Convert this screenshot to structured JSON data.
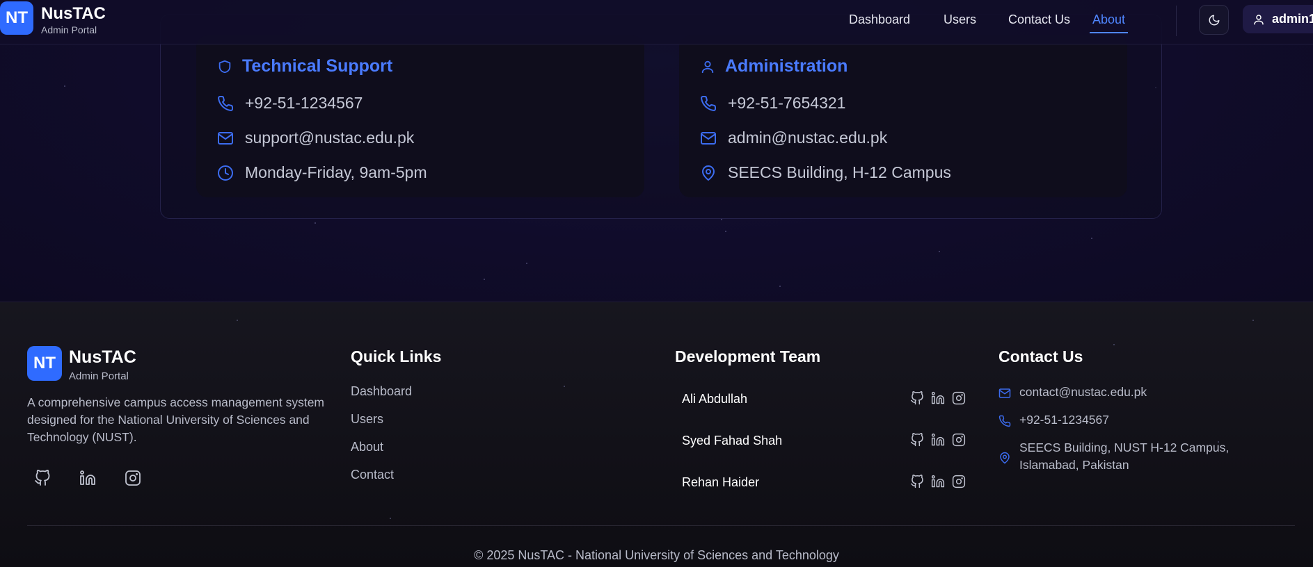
{
  "header": {
    "logo_text": "NT",
    "brand": "NusTAC",
    "subtitle": "Admin Portal",
    "nav": [
      {
        "label": "Dashboard",
        "active": false
      },
      {
        "label": "Users",
        "active": false
      },
      {
        "label": "Contact Us",
        "active": false
      },
      {
        "label": "About",
        "active": true
      }
    ],
    "theme_icon": "moon-icon",
    "user_label": "admin1"
  },
  "contact_cards": [
    {
      "title": "Technical Support",
      "title_icon": "shield-icon",
      "rows": [
        {
          "icon": "phone-icon",
          "text": "+92-51-1234567"
        },
        {
          "icon": "mail-icon",
          "text": "support@nustac.edu.pk"
        },
        {
          "icon": "clock-icon",
          "text": "Monday-Friday, 9am-5pm"
        }
      ]
    },
    {
      "title": "Administration",
      "title_icon": "user-icon",
      "rows": [
        {
          "icon": "phone-icon",
          "text": "+92-51-7654321"
        },
        {
          "icon": "mail-icon",
          "text": "admin@nustac.edu.pk"
        },
        {
          "icon": "map-pin-icon",
          "text": "SEECS Building, H-12 Campus"
        }
      ]
    }
  ],
  "footer": {
    "logo_text": "NT",
    "brand": "NusTAC",
    "subtitle": "Admin Portal",
    "description": "A comprehensive campus access management system designed for the National University of Sciences and Technology (NUST).",
    "social_icons": [
      "github-icon",
      "linkedin-icon",
      "instagram-icon"
    ],
    "quick_links_heading": "Quick Links",
    "quick_links": [
      "Dashboard",
      "Users",
      "About",
      "Contact"
    ],
    "team_heading": "Development Team",
    "team": [
      "Ali Abdullah",
      "Syed Fahad Shah",
      "Rehan Haider"
    ],
    "contact_heading": "Contact Us",
    "contact": {
      "email": "contact@nustac.edu.pk",
      "phone": "+92-51-1234567",
      "address": "SEECS Building, NUST H-12 Campus, Islamabad, Pakistan"
    },
    "copyright": "© 2025 NusTAC - National University of Sciences and Technology"
  },
  "colors": {
    "accent": "#2f6bff",
    "link_active": "#4f86ff",
    "background": "#0e0b22",
    "footer_background": "#121118"
  }
}
